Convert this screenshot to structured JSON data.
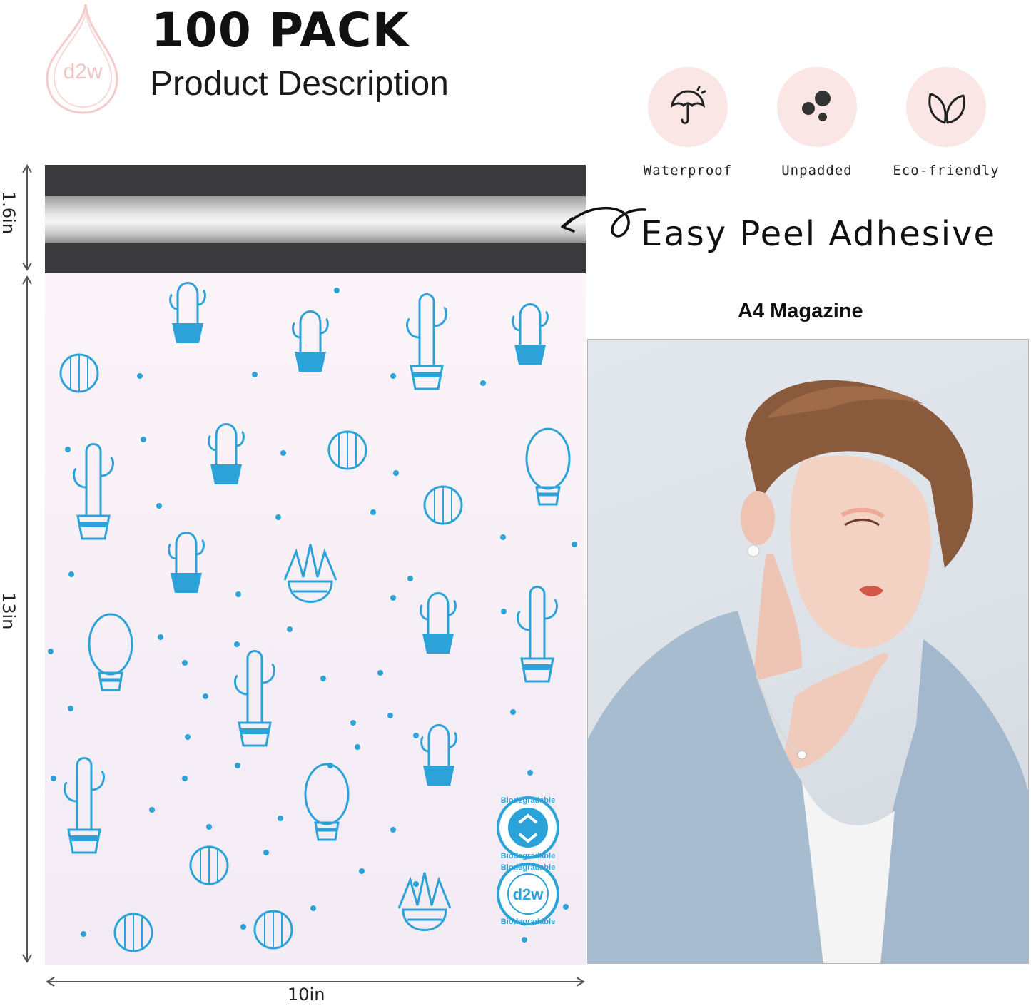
{
  "header": {
    "logo_text": "d2w",
    "title": "100 PACK",
    "subtitle": "Product Description"
  },
  "features": [
    {
      "label": "Waterproof",
      "icon": "umbrella-icon"
    },
    {
      "label": "Unpadded",
      "icon": "dots-icon"
    },
    {
      "label": "Eco-friendly",
      "icon": "leaf-icon"
    }
  ],
  "adhesive_label": "Easy Peel Adhesive",
  "dimensions": {
    "flap_height": "1.6in",
    "bag_height": "13in",
    "bag_width": "10in"
  },
  "comparison_label": "A4 Magazine",
  "badges": {
    "biodegradable": "Biodegradable",
    "d2w": "d2w"
  },
  "colors": {
    "accent_blue": "#2ba3d9",
    "badge_pink": "#fbe6e6",
    "strip_dark": "#3a3a3c"
  }
}
